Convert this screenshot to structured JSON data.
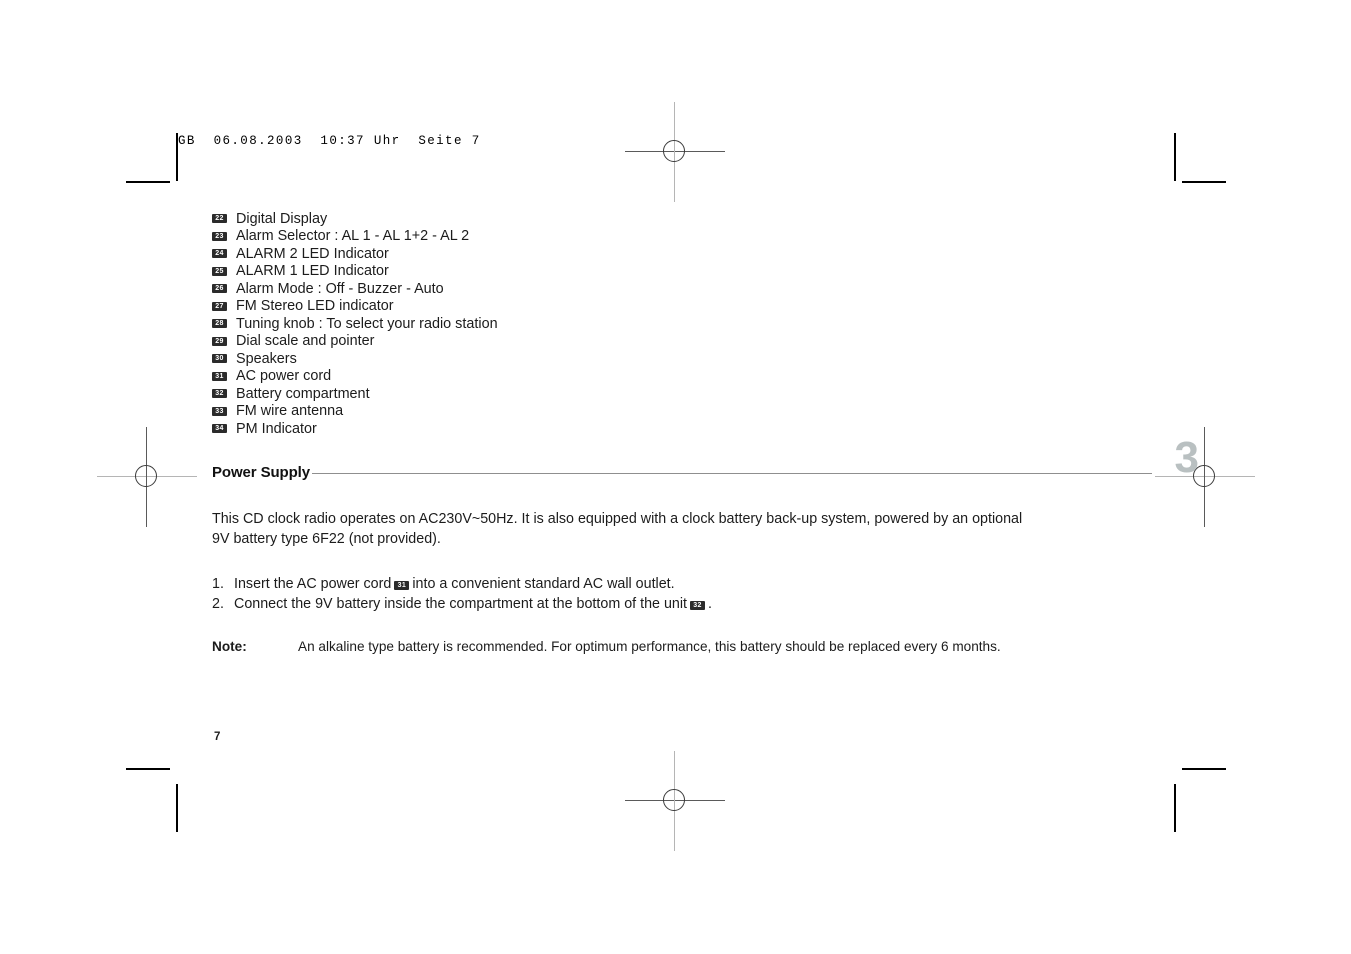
{
  "file_header": "GB  06.08.2003  10:37 Uhr  Seite 7",
  "features": [
    {
      "num": "22",
      "label": "Digital Display"
    },
    {
      "num": "23",
      "label": "Alarm Selector : AL 1 - AL 1+2 - AL 2"
    },
    {
      "num": "24",
      "label": "ALARM 2 LED Indicator"
    },
    {
      "num": "25",
      "label": "ALARM 1 LED Indicator"
    },
    {
      "num": "26",
      "label": "Alarm Mode : Off - Buzzer - Auto"
    },
    {
      "num": "27",
      "label": "FM Stereo LED indicator"
    },
    {
      "num": "28",
      "label": "Tuning knob : To select your radio station"
    },
    {
      "num": "29",
      "label": "Dial scale and pointer"
    },
    {
      "num": "30",
      "label": "Speakers"
    },
    {
      "num": "31",
      "label": "AC power cord"
    },
    {
      "num": "32",
      "label": "Battery compartment"
    },
    {
      "num": "33",
      "label": "FM wire antenna"
    },
    {
      "num": "34",
      "label": "PM Indicator"
    }
  ],
  "section": {
    "title": "Power Supply",
    "chapter_number": "3"
  },
  "intro_paragraph": "This CD clock radio operates on AC230V~50Hz. It is also equipped with a clock battery back-up system, powered by an optional 9V battery type 6F22 (not provided).",
  "steps": [
    {
      "number": "1.",
      "text_before": "Insert the AC power cord",
      "badge": "31",
      "text_after": "into a convenient standard AC wall outlet."
    },
    {
      "number": "2.",
      "text_before": "Connect the 9V battery inside the compartment at the bottom of the unit",
      "badge": "32",
      "text_after": "."
    }
  ],
  "note": {
    "label": "Note:",
    "text": "An alkaline type battery is recommended. For optimum performance, this battery should be replaced every 6 months."
  },
  "folio": "7",
  "colors": {
    "chapter_number": "#b9c0c1",
    "rule": "#8f8f8f",
    "badge_bg": "#2b2b2b",
    "text": "#1c1c1c"
  }
}
